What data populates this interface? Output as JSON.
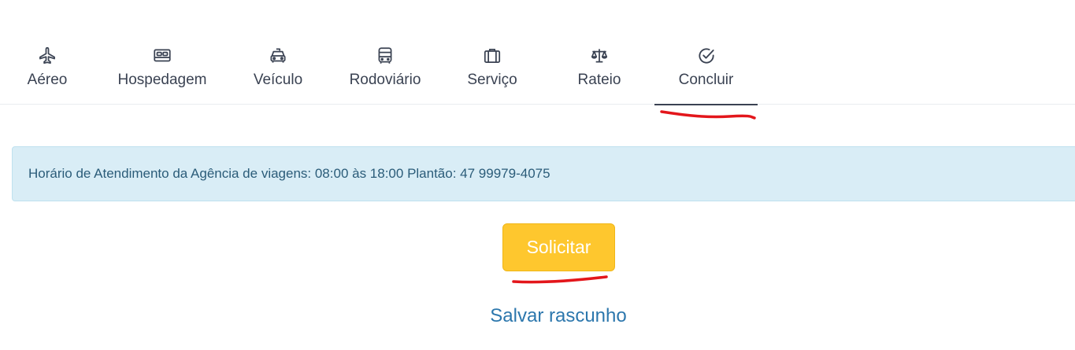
{
  "tabs": [
    {
      "label": "Aéreo",
      "icon": "airplane-icon"
    },
    {
      "label": "Hospedagem",
      "icon": "bed-icon"
    },
    {
      "label": "Veículo",
      "icon": "car-icon"
    },
    {
      "label": "Rodoviário",
      "icon": "bus-icon"
    },
    {
      "label": "Serviço",
      "icon": "briefcase-icon"
    },
    {
      "label": "Rateio",
      "icon": "scale-icon"
    },
    {
      "label": "Concluir",
      "icon": "check-circle-icon",
      "active": true
    }
  ],
  "alert": {
    "text": "Horário de Atendimento da Agência de viagens: 08:00 às 18:00 Plantão: 47 99979-4075"
  },
  "actions": {
    "submit_label": "Solicitar",
    "draft_label": "Salvar rascunho"
  },
  "colors": {
    "accent": "#fec72e",
    "link": "#2c77ad",
    "alert_bg": "#d9edf6",
    "annotation": "#e3161b"
  }
}
